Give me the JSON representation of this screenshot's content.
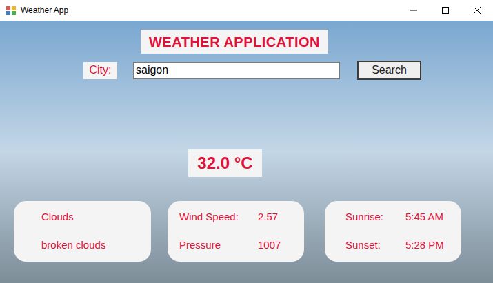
{
  "window": {
    "title": "Weather App"
  },
  "header": {
    "title": "WEATHER APPLICATION"
  },
  "search": {
    "label": "City:",
    "value": "saigon",
    "button": "Search"
  },
  "temperature": "32.0 °C",
  "weather": {
    "main": "Clouds",
    "description": "broken clouds"
  },
  "details": [
    {
      "label": "Wind Speed:",
      "value": "2.57"
    },
    {
      "label": "Pressure",
      "value": "1007"
    }
  ],
  "sun": [
    {
      "label": "Sunrise:",
      "value": "5:45 AM"
    },
    {
      "label": "Sunset:",
      "value": "5:28 PM"
    }
  ]
}
